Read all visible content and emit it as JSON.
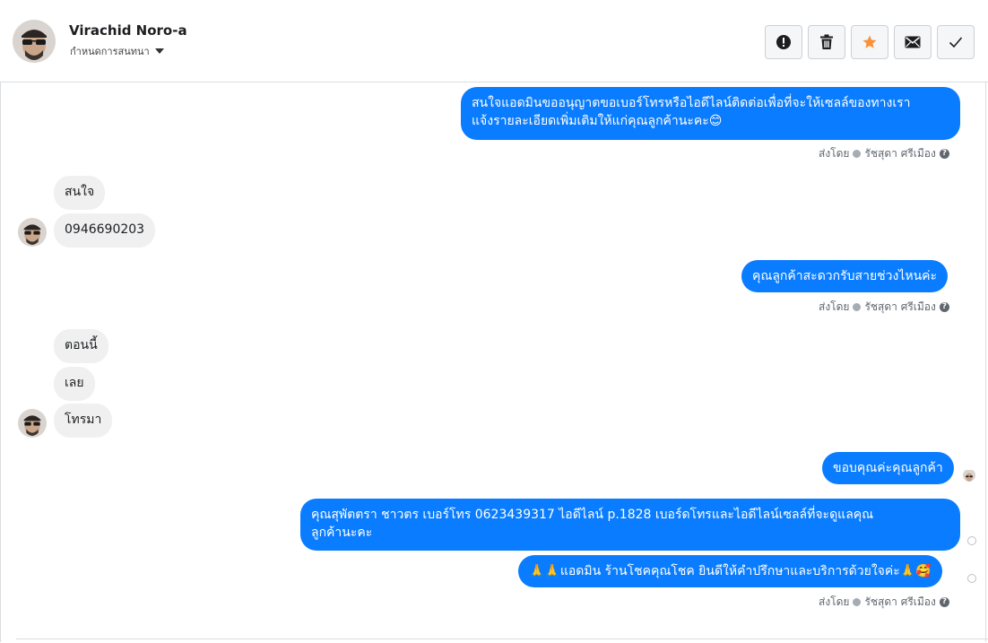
{
  "header": {
    "user_name": "Virachid Noro-a",
    "assign_label": "กำหนดการสนทนา",
    "actions": [
      "alert-icon",
      "trash-icon",
      "star-icon",
      "mail-icon",
      "check-icon"
    ],
    "star_color": "#f7923a"
  },
  "colors": {
    "outgoing": "#0a7cff",
    "incoming": "#f0f0f0"
  },
  "messages": [
    {
      "dir": "out",
      "text_lines": [
        "สนใจแอดมินขออนุญาตขอเบอร์โทรหรือไอดีไลน์ติดต่อเพื่อที่จะให้เซลล์ของทางเรา",
        "แจ้งรายละเอียดเพิ่มเติมให้แก่คุณลูกค้านะคะ😊"
      ]
    },
    {
      "dir": "in",
      "text": "สนใจ"
    },
    {
      "dir": "in",
      "text": "0946690203"
    },
    {
      "dir": "out",
      "text": "คุณลูกค้าสะดวกรับสายช่วงไหนค่ะ"
    },
    {
      "dir": "in",
      "text": "ตอนนี้"
    },
    {
      "dir": "in",
      "text": "เลย"
    },
    {
      "dir": "in",
      "text": "โทรมา"
    },
    {
      "dir": "out",
      "text": "ขอบคุณค่ะคุณลูกค้า"
    },
    {
      "dir": "out",
      "text_lines": [
        "คุณสุพัตตรา   ชาวตร      เบอร์โทร 0623439317  ไอดีไลน์ p.1828   เบอร์ดโทรและไอดีไลน์เซลล์ที่จะดูแลคุณ",
        "ลูกค้านะคะ"
      ]
    },
    {
      "dir": "out",
      "text": "🙏🙏แอดมิน ร้านโชคคุณโชค ยินดีให้คำปรึกษาและบริการด้วยใจค่ะ🙏🥰"
    }
  ],
  "sent_by": {
    "prefix": "ส่งโดย",
    "agent": "รัชสุดา ศรีเมือง",
    "help": "?"
  }
}
